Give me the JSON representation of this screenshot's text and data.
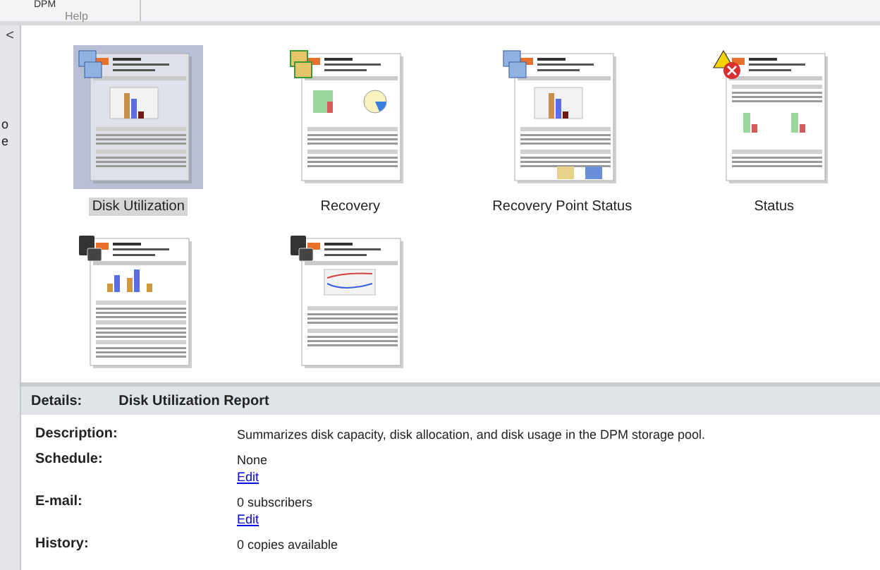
{
  "ribbon": {
    "tab": "DPM",
    "group": "Help"
  },
  "side_pane": {
    "collapse": "<",
    "texts": [
      "o",
      "e"
    ]
  },
  "reports": [
    {
      "label": "Disk Utilization",
      "selected": true,
      "kind": "bars"
    },
    {
      "label": "Recovery",
      "selected": false,
      "kind": "pie"
    },
    {
      "label": "Recovery Point Status",
      "selected": false,
      "kind": "bars-mail"
    },
    {
      "label": "Status",
      "selected": false,
      "kind": "status"
    },
    {
      "selected": false,
      "kind": "grouped"
    },
    {
      "selected": false,
      "kind": "line"
    }
  ],
  "details": {
    "label": "Details:",
    "title": "Disk Utilization Report",
    "rows": [
      {
        "label": "Description:",
        "value": "Summarizes disk capacity, disk allocation, and disk usage in the DPM storage pool."
      },
      {
        "label": "Schedule:",
        "value": "None",
        "link": "Edit"
      },
      {
        "label": "E-mail:",
        "value": "0 subscribers",
        "link": "Edit"
      },
      {
        "label": "History:",
        "value": "0 copies available"
      }
    ]
  }
}
